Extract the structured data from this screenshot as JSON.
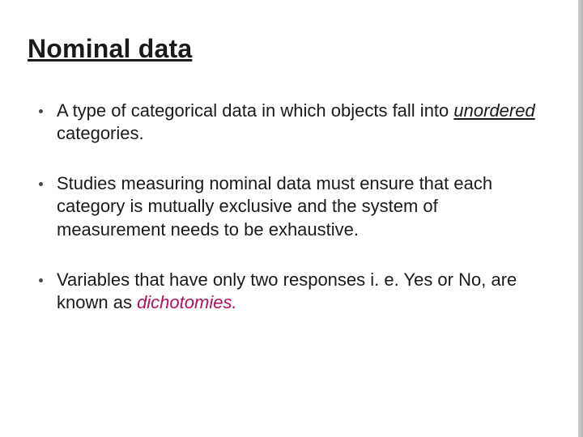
{
  "title": "Nominal data",
  "bullets": [
    {
      "pre": "A type of categorical data in which objects fall into ",
      "em": "unordered",
      "em_class": "em-under",
      "post": " categories."
    },
    {
      "pre": "Studies measuring nominal data must ensure that each category is mutually exclusive and the system of measurement needs to be exhaustive.",
      "em": "",
      "em_class": "",
      "post": ""
    },
    {
      "pre": " Variables that have only two responses i. e. Yes or No, are known as ",
      "em": "dichotomies.",
      "em_class": "em-color",
      "post": ""
    }
  ]
}
